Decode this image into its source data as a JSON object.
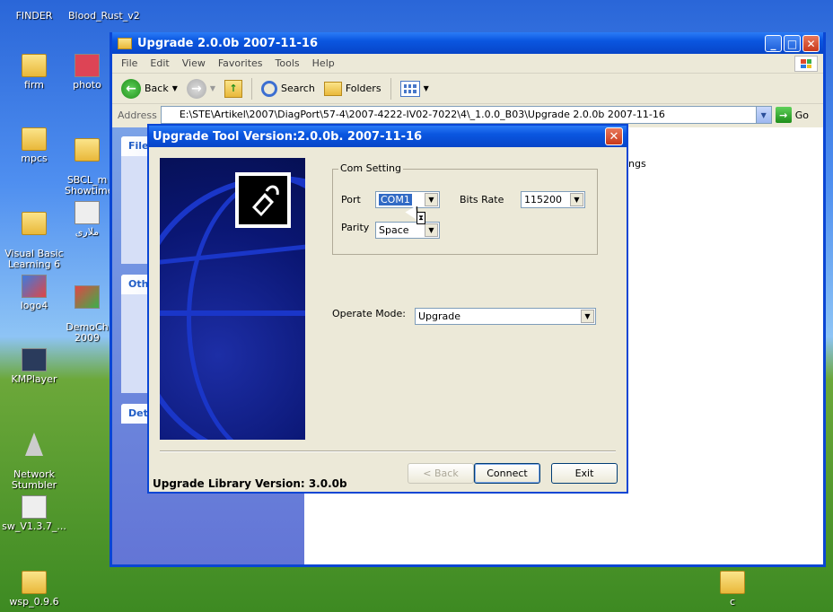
{
  "desktop": {
    "icons": [
      {
        "label": "FINDER"
      },
      {
        "label": "Blood_Rust_v2"
      },
      {
        "label": "firm"
      },
      {
        "label": "photo"
      },
      {
        "label": "mpcs"
      },
      {
        "label": "SBCL_m\nShowtime"
      },
      {
        "label": "Visual Basic\nLearning 6"
      },
      {
        "label": "ملاری"
      },
      {
        "label": "logo4"
      },
      {
        "label": "DemoCh\n2009"
      },
      {
        "label": "KMPlayer"
      },
      {
        "label": "Network\nStumbler"
      },
      {
        "label": "sw_V1.3.7_..."
      },
      {
        "label": "wsp_0.9.6"
      },
      {
        "label": "c"
      }
    ]
  },
  "explorer": {
    "title": "Upgrade 2.0.0b 2007-11-16",
    "menu": [
      "File",
      "Edit",
      "View",
      "Favorites",
      "Tools",
      "Help"
    ],
    "toolbar": {
      "back": "Back",
      "search": "Search",
      "folders": "Folders"
    },
    "address_label": "Address",
    "address_value": "E:\\STE\\Artikel\\2007\\DiagPort\\57-4\\2007-4222-IV02-7022\\4\\_1.0.0_B03\\Upgrade 2.0.0b 2007-11-16",
    "go": "Go",
    "taskpane_headers": [
      "File",
      "Other",
      "Det"
    ],
    "filelist_text": "ings"
  },
  "dialog": {
    "title": "Upgrade Tool Version:2.0.0b. 2007-11-16",
    "com_setting_legend": "Com Setting",
    "port_label": "Port",
    "port_value": "COM1",
    "bits_rate_label": "Bits Rate",
    "bits_rate_value": "115200",
    "parity_label": "Parity",
    "parity_value": "Space",
    "operate_mode_label": "Operate Mode:",
    "operate_mode_value": "Upgrade",
    "back_button": "< Back",
    "connect_button": "Connect",
    "exit_button": "Exit",
    "library_version": "Upgrade Library Version: 3.0.0b"
  },
  "colors": {
    "xp_title_blue": "#0a56e0",
    "dialog_face": "#ece9d8",
    "selection_blue": "#316ac5"
  }
}
